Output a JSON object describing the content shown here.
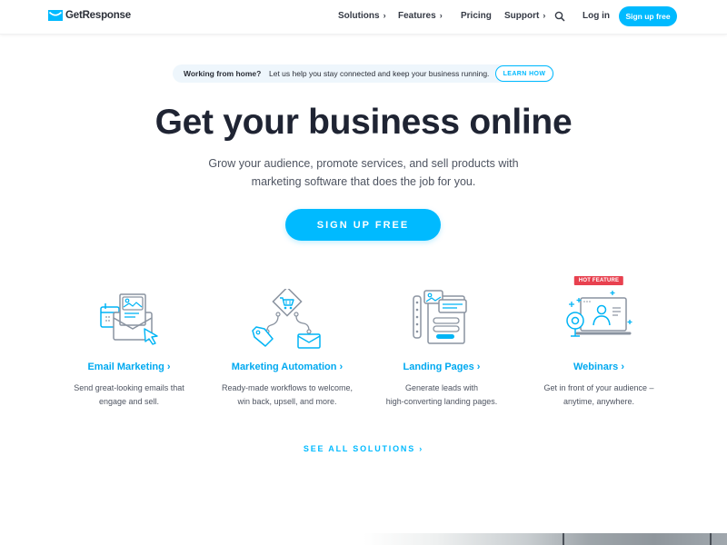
{
  "nav": {
    "logo_text": "GetResponse",
    "items": [
      {
        "label": "Solutions",
        "has_chevron": true
      },
      {
        "label": "Features",
        "has_chevron": true
      },
      {
        "label": "Pricing",
        "has_chevron": false
      },
      {
        "label": "Support",
        "has_chevron": true
      }
    ],
    "chevron": "›",
    "search_icon": "search-icon",
    "login_label": "Log in",
    "signup_label": "Sign up free"
  },
  "banner": {
    "title": "Working from home?",
    "text": "Let us help you stay connected and keep your business running.",
    "button_label": "LEARN HOW"
  },
  "hero": {
    "title": "Get your business online",
    "subtitle_line1": "Grow your audience, promote services, and sell products with",
    "subtitle_line2": "marketing software that does the job for you.",
    "cta_label": "SIGN UP FREE"
  },
  "features": [
    {
      "title": "Email Marketing ›",
      "desc_line1": "Send great-looking emails that",
      "desc_line2": "engage and sell.",
      "icon": "email-marketing-icon"
    },
    {
      "title": "Marketing Automation ›",
      "desc_line1": "Ready-made workflows to welcome,",
      "desc_line2": "win back, upsell, and more.",
      "icon": "marketing-automation-icon"
    },
    {
      "title": "Landing Pages ›",
      "desc_line1": "Generate leads with",
      "desc_line2": "high-converting landing pages.",
      "icon": "landing-pages-icon"
    },
    {
      "title": "Webinars ›",
      "desc_line1": "Get in front of your audience –",
      "desc_line2": "anytime, anywhere.",
      "icon": "webinars-icon",
      "badge": "HOT FEATURE"
    }
  ],
  "see_all_label": "SEE ALL SOLUTIONS ›",
  "colors": {
    "brand": "#00baff",
    "link": "#00a9f0",
    "heading": "#1f2433",
    "hot_badge": "#e8414f",
    "banner_bg": "#eef6fc"
  }
}
